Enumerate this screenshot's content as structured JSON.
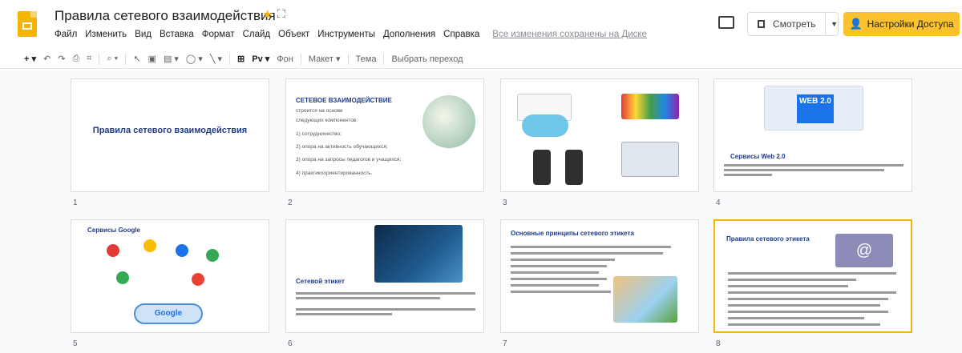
{
  "header": {
    "doc_title": "Правила сетевого взаимодействия",
    "menu": [
      "Файл",
      "Изменить",
      "Вид",
      "Вставка",
      "Формат",
      "Слайд",
      "Объект",
      "Инструменты",
      "Дополнения",
      "Справка"
    ],
    "saved_status": "Все изменения сохранены на Диске",
    "present_label": "Смотреть",
    "share_label": "Настройки Доступа"
  },
  "toolbar": {
    "background_label": "Фон",
    "layout_label": "Макет",
    "theme_label": "Тема",
    "transition_label": "Выбрать переход"
  },
  "slides": [
    {
      "num": "1",
      "title": "Правила сетевого взаимодействия"
    },
    {
      "num": "2",
      "title": "СЕТЕВОЕ ВЗАИМОДЕЙСТВИЕ",
      "lines": [
        "строится на основе",
        "следующих компонентов:",
        "1) сотрудничество;",
        "2) опора на активность обучающихся;",
        "3) опора на запросы педагогов и учащихся;",
        "4) практикоориентированность."
      ]
    },
    {
      "num": "3"
    },
    {
      "num": "4",
      "title": "Сервисы Web 2.0",
      "badge": "WEB 2.0"
    },
    {
      "num": "5",
      "title": "Сервисы Google",
      "center_label": "Google"
    },
    {
      "num": "6",
      "title": "Сетевой этикет"
    },
    {
      "num": "7",
      "title": "Основные принципы сетевого этикета"
    },
    {
      "num": "8",
      "title": "Правила сетевого этикета"
    }
  ]
}
